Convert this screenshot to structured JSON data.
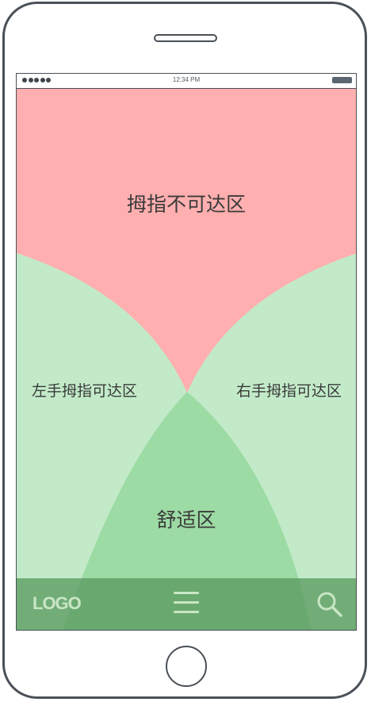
{
  "status_bar": {
    "time": "12:34 PM"
  },
  "zones": {
    "unreachable": "拇指不可达区",
    "left_thumb": "左手拇指可达区",
    "right_thumb": "右手拇指可达区",
    "comfort": "舒适区"
  },
  "nav": {
    "logo": "LOGO",
    "menu_icon": "menu-icon",
    "search_icon": "search-icon"
  },
  "colors": {
    "unreachable": "#ffafaf",
    "reachable": "#c2eac8",
    "comfort": "#9cdba4",
    "nav": "#5b9b62",
    "nav_icons": "#c9e6c6",
    "frame": "#4a5058"
  }
}
